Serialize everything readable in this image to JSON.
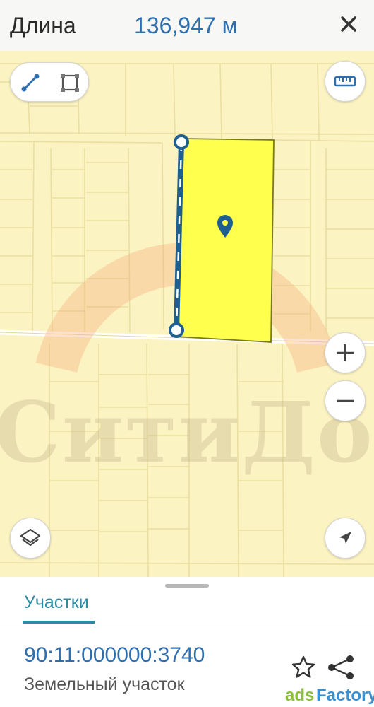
{
  "measure": {
    "label": "Длина",
    "value": "136,947 м"
  },
  "map": {
    "watermark": "СитиДом"
  },
  "sheet": {
    "tab_label": "Участки",
    "cadastral_number": "90:11:000000:3740",
    "parcel_type": "Земельный участок"
  },
  "branding": {
    "ads_part1": "ads",
    "ads_part2": "Factory"
  },
  "icons": {
    "close": "close-icon",
    "line_tool": "line-measure-icon",
    "area_tool": "area-measure-icon",
    "ruler": "ruler-icon",
    "zoom_in": "plus-icon",
    "zoom_out": "minus-icon",
    "layers": "layers-icon",
    "locate": "navigation-arrow-icon",
    "favorite": "star-icon",
    "share": "share-icon",
    "parcel_marker": "map-pin-icon"
  },
  "colors": {
    "accent": "#2f6fb0",
    "tab": "#2f8aa3",
    "parcel_fill": "#ffff4d",
    "map_bg": "#fbf3c2",
    "line": "#1f5f8f"
  }
}
